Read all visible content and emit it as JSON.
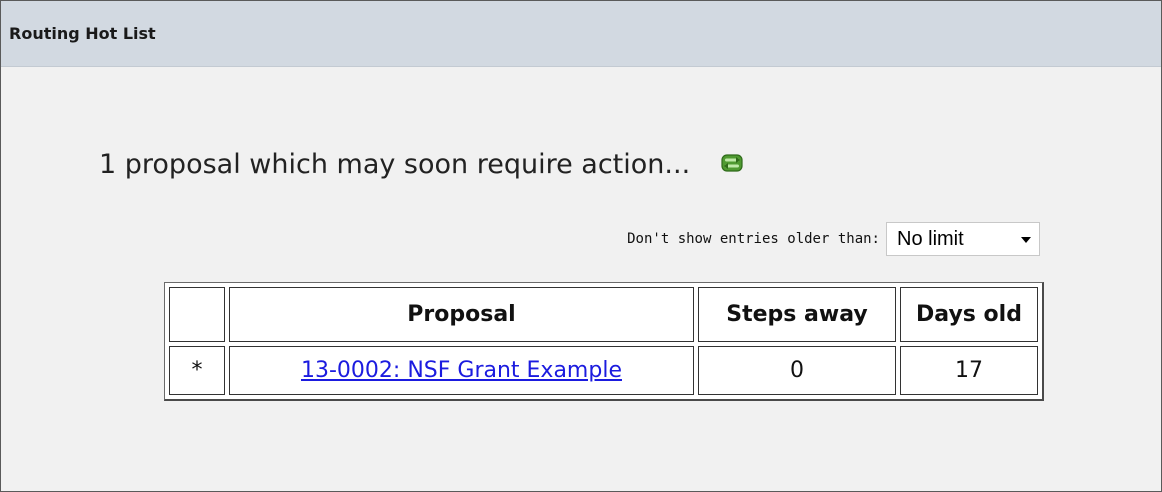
{
  "panel": {
    "title": "Routing Hot List"
  },
  "summary": {
    "text": "1 proposal which may soon require action...",
    "refresh_icon": "refresh-icon"
  },
  "filter": {
    "label": "Don't show entries older than:",
    "selected": "No limit"
  },
  "table": {
    "headers": [
      "",
      "Proposal",
      "Steps away",
      "Days old"
    ],
    "rows": [
      {
        "marker": "*",
        "proposal": "13-0002: NSF Grant Example",
        "steps_away": "0",
        "days_old": "17"
      }
    ]
  },
  "colors": {
    "header_bg": "#d2d9e1",
    "panel_bg": "#f1f1f1",
    "link": "#1b1bdf",
    "refresh_icon": "#4f9a31"
  }
}
